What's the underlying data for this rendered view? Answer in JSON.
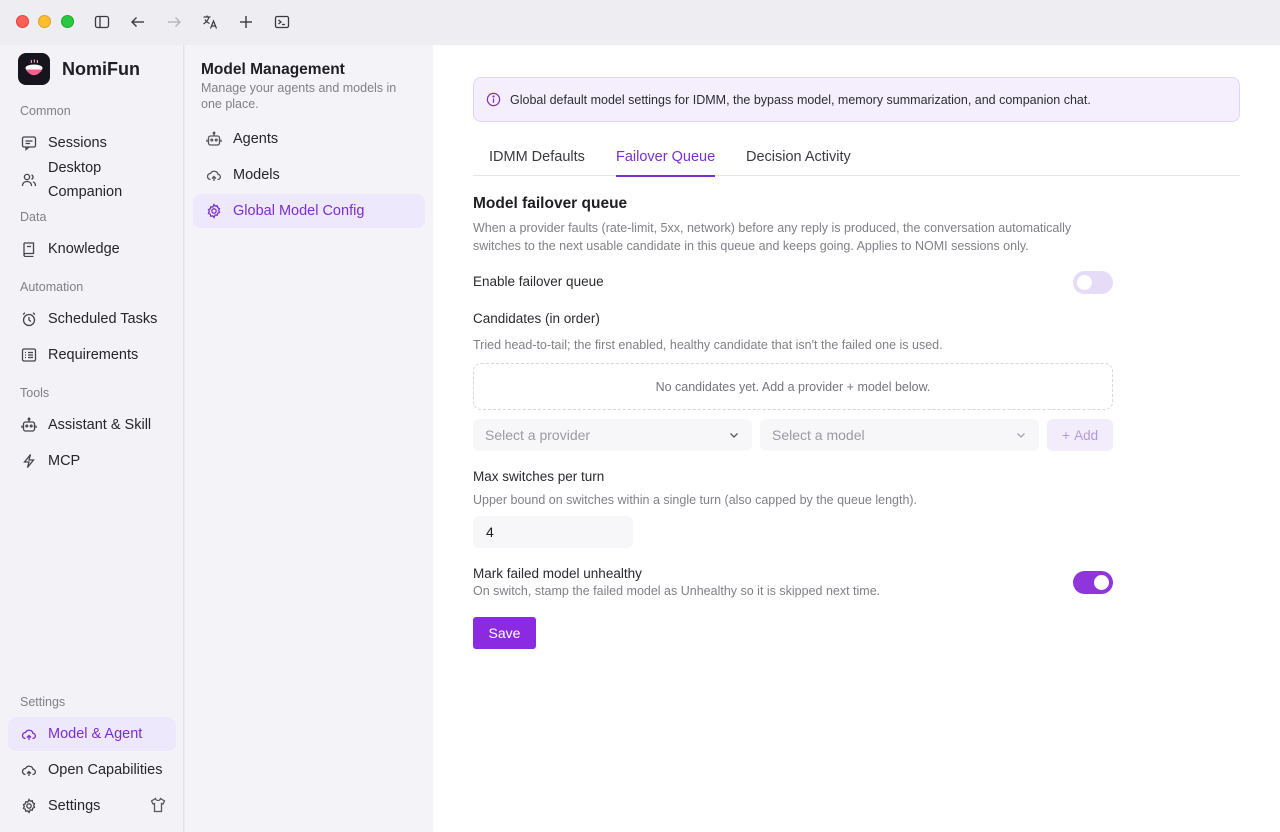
{
  "app": {
    "name": "NomiFun"
  },
  "sidebar": {
    "sections": [
      {
        "label": "Common"
      },
      {
        "label": "Data"
      },
      {
        "label": "Automation"
      },
      {
        "label": "Tools"
      },
      {
        "label": "Settings"
      }
    ],
    "items": [
      {
        "label": "Sessions",
        "icon": "chat-icon"
      },
      {
        "label": "Desktop Companion",
        "icon": "users-icon"
      },
      {
        "label": "Knowledge",
        "icon": "book-icon"
      },
      {
        "label": "Scheduled Tasks",
        "icon": "alarm-icon"
      },
      {
        "label": "Requirements",
        "icon": "list-icon"
      },
      {
        "label": "Assistant & Skill",
        "icon": "robot-icon"
      },
      {
        "label": "MCP",
        "icon": "lightning-icon"
      },
      {
        "label": "Model & Agent",
        "icon": "cloud-icon"
      },
      {
        "label": "Open Capabilities",
        "icon": "cloud-icon"
      },
      {
        "label": "Settings",
        "icon": "gear-icon"
      }
    ]
  },
  "panel": {
    "title": "Model Management",
    "subtitle": "Manage your agents and models in one place.",
    "items": [
      {
        "label": "Agents",
        "icon": "robot-icon"
      },
      {
        "label": "Models",
        "icon": "cloud-icon"
      },
      {
        "label": "Global Model Config",
        "icon": "gear-icon"
      }
    ]
  },
  "main": {
    "banner": "Global default model settings for IDMM, the bypass model, memory summarization, and companion chat.",
    "tabs": [
      {
        "label": "IDMM Defaults"
      },
      {
        "label": "Failover Queue"
      },
      {
        "label": "Decision Activity"
      }
    ],
    "active_tab": "Failover Queue",
    "section_title": "Model failover queue",
    "section_desc": "When a provider faults (rate-limit, 5xx, network) before any reply is produced, the conversation automatically switches to the next usable candidate in this queue and keeps going. Applies to NOMI sessions only.",
    "enable_label": "Enable failover queue",
    "enable_on": false,
    "candidates_label": "Candidates (in order)",
    "candidates_help": "Tried head-to-tail; the first enabled, healthy candidate that isn't the failed one is used.",
    "candidates_empty": "No candidates yet. Add a provider + model below.",
    "provider_placeholder": "Select a provider",
    "model_placeholder": "Select a model",
    "add_label": "Add",
    "max_switches_label": "Max switches per turn",
    "max_switches_help": "Upper bound on switches within a single turn (also capped by the queue length).",
    "max_switches_value": "4",
    "unhealthy_label": "Mark failed model unhealthy",
    "unhealthy_help": "On switch, stamp the failed model as Unhealthy so it is skipped next time.",
    "unhealthy_on": true,
    "save_label": "Save"
  },
  "colors": {
    "accent": "#8a2be2",
    "accent_text": "#7a2fd0",
    "active_bg": "#ede8fb"
  }
}
